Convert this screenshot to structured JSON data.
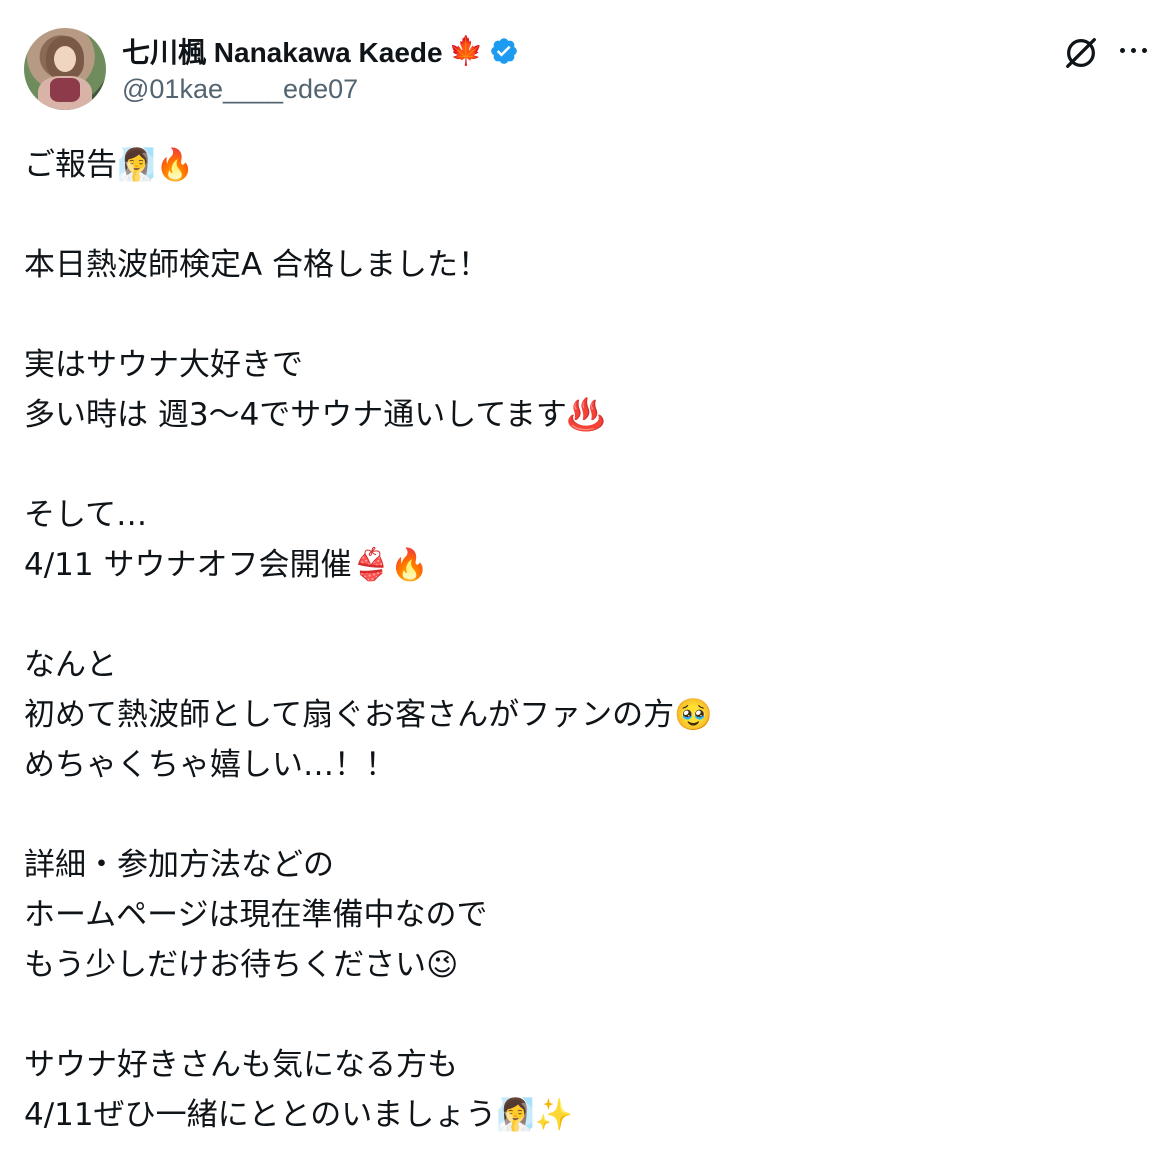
{
  "author": {
    "display_name": "七川楓 Nanakawa Kaede",
    "handle": "@01kae____ede07",
    "flag_emoji": "🍁",
    "verified": true,
    "verified_color": "#1d9bf0"
  },
  "actions": {
    "grok_icon": "grok-icon",
    "more_icon": "more-icon"
  },
  "tweet": {
    "lines": [
      "ご報告🧖‍♀️🔥",
      "",
      "本日熱波師検定A 合格しました！",
      "",
      "実はサウナ大好きで",
      "多い時は 週3〜4でサウナ通いしてます♨️",
      "",
      "そして…",
      "4/11 サウナオフ会開催👙🔥",
      "",
      "なんと",
      "初めて熱波師として扇ぐお客さんがファンの方🥹",
      "めちゃくちゃ嬉しい…！！",
      "",
      "詳細・参加方法などの",
      "ホームページは現在準備中なので",
      "もう少しだけお待ちください😉",
      "",
      "サウナ好きさんも気になる方も",
      "4/11ぜひ一緒にととのいましょう🧖‍♀️✨"
    ]
  }
}
